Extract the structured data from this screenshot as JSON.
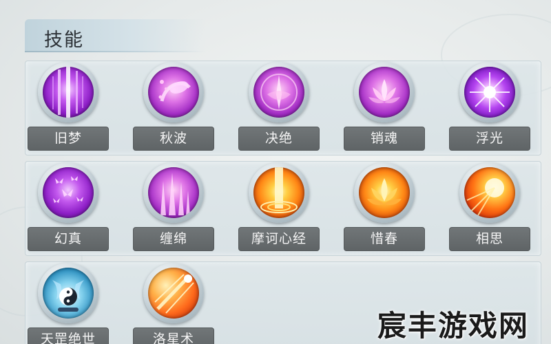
{
  "panel": {
    "title": "技能"
  },
  "skills": [
    {
      "label": "旧梦",
      "icon": "purple-light-beams-icon"
    },
    {
      "label": "秋波",
      "icon": "purple-petal-swirl-icon"
    },
    {
      "label": "决绝",
      "icon": "pink-lotus-blade-icon"
    },
    {
      "label": "销魂",
      "icon": "pink-lotus-flower-icon"
    },
    {
      "label": "浮光",
      "icon": "violet-light-burst-icon"
    },
    {
      "label": "幻真",
      "icon": "purple-butterflies-icon"
    },
    {
      "label": "缠绵",
      "icon": "purple-crystal-stalks-icon"
    },
    {
      "label": "摩诃心经",
      "icon": "fire-pillar-icon"
    },
    {
      "label": "惜春",
      "icon": "fire-lotus-icon"
    },
    {
      "label": "相思",
      "icon": "fire-burst-icon"
    },
    {
      "label": "天罡绝世",
      "icon": "blue-yin-yang-icon"
    },
    {
      "label": "洛星术",
      "icon": "amber-comet-streak-icon"
    }
  ],
  "watermark": "宸丰游戏网"
}
